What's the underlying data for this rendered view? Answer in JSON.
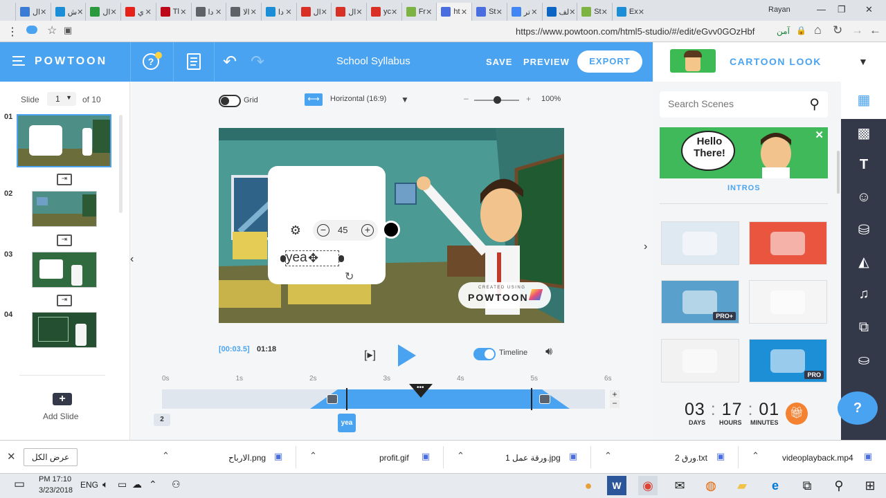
{
  "browser": {
    "tabs": [
      {
        "label": "ال",
        "color": "#3a7bd5"
      },
      {
        "label": "ش",
        "color": "#1c8ed8"
      },
      {
        "label": "ال",
        "color": "#2b9a3e"
      },
      {
        "label": "ي",
        "color": "#e62117"
      },
      {
        "label": "Tl",
        "color": "#bd081c"
      },
      {
        "label": "دا",
        "color": "#5f6368"
      },
      {
        "label": "الا",
        "color": "#5f6368"
      },
      {
        "label": "دا",
        "color": "#1c8ed8"
      },
      {
        "label": "ال",
        "color": "#d93025"
      },
      {
        "label": "ال",
        "color": "#d93025"
      },
      {
        "label": "yc",
        "color": "#d93025"
      },
      {
        "label": "Fr",
        "color": "#7cb342"
      },
      {
        "label": "ht",
        "color": "#4a6ee0"
      },
      {
        "label": "St",
        "color": "#4a6ee0"
      },
      {
        "label": "تر",
        "color": "#4285f4"
      },
      {
        "label": "لف",
        "color": "#0a66c2"
      },
      {
        "label": "St",
        "color": "#7cb342"
      },
      {
        "label": "Ex",
        "color": "#1c8ed8"
      }
    ],
    "profile": "Rayan",
    "url": "https://www.powtoon.com/html5-studio/#/edit/eGvv0GOzHbf",
    "secure_label": "آمن"
  },
  "header": {
    "logo": "POWTOON",
    "project_title": "School Syllabus",
    "save": "SAVE",
    "preview": "PREVIEW",
    "export": "EXPORT",
    "style_label": "CARTOON LOOK"
  },
  "slides": {
    "label": "Slide",
    "current": "1",
    "of": "of 10",
    "numbers": [
      "01",
      "02",
      "03",
      "04"
    ],
    "add_label": "Add Slide"
  },
  "toolbar": {
    "grid_label": "Grid",
    "orientation": "Horizontal (16:9)",
    "zoom": "100%",
    "zoom_level": 0.5
  },
  "canvas": {
    "font_size": "45",
    "text_value": "yea",
    "watermark_small": "CREATED USING",
    "watermark_big": "POWTOON"
  },
  "player": {
    "current_time": "[00:03.5]",
    "duration": "01:18",
    "timeline_label": "Timeline",
    "ticks": [
      "0s",
      "1s",
      "2s",
      "3s",
      "4s",
      "5s",
      "6s"
    ],
    "layer_tag": "yea",
    "slide_marker": "2"
  },
  "right_panel": {
    "search_placeholder": "Search Scenes",
    "featured_label": "INTROS",
    "featured_text": "Hello There!",
    "thumbs": [
      {
        "bg": "#dfe9f2",
        "tag": ""
      },
      {
        "bg": "#e9553f",
        "tag": ""
      },
      {
        "bg": "#5aa0cc",
        "tag": "PRO+"
      },
      {
        "bg": "#f5f5f5",
        "tag": ""
      },
      {
        "bg": "#f2f2f2",
        "tag": ""
      },
      {
        "bg": "#1d8fd6",
        "tag": "PRO"
      }
    ],
    "countdown": {
      "days": "03",
      "hours": "17",
      "minutes": "01",
      "days_label": "DAYS",
      "hours_label": "HOURS",
      "minutes_label": "MINUTES"
    },
    "help": "?"
  },
  "downloads": {
    "show_all": "عرض الكل",
    "files": [
      "الارباح.png",
      "profit.gif",
      "ورقة عمل 1.jpg",
      "ورق 2.txt",
      "videoplayback.mp4"
    ]
  },
  "taskbar": {
    "time": "PM 17:10",
    "date": "3/23/2018",
    "lang": "ENG"
  }
}
